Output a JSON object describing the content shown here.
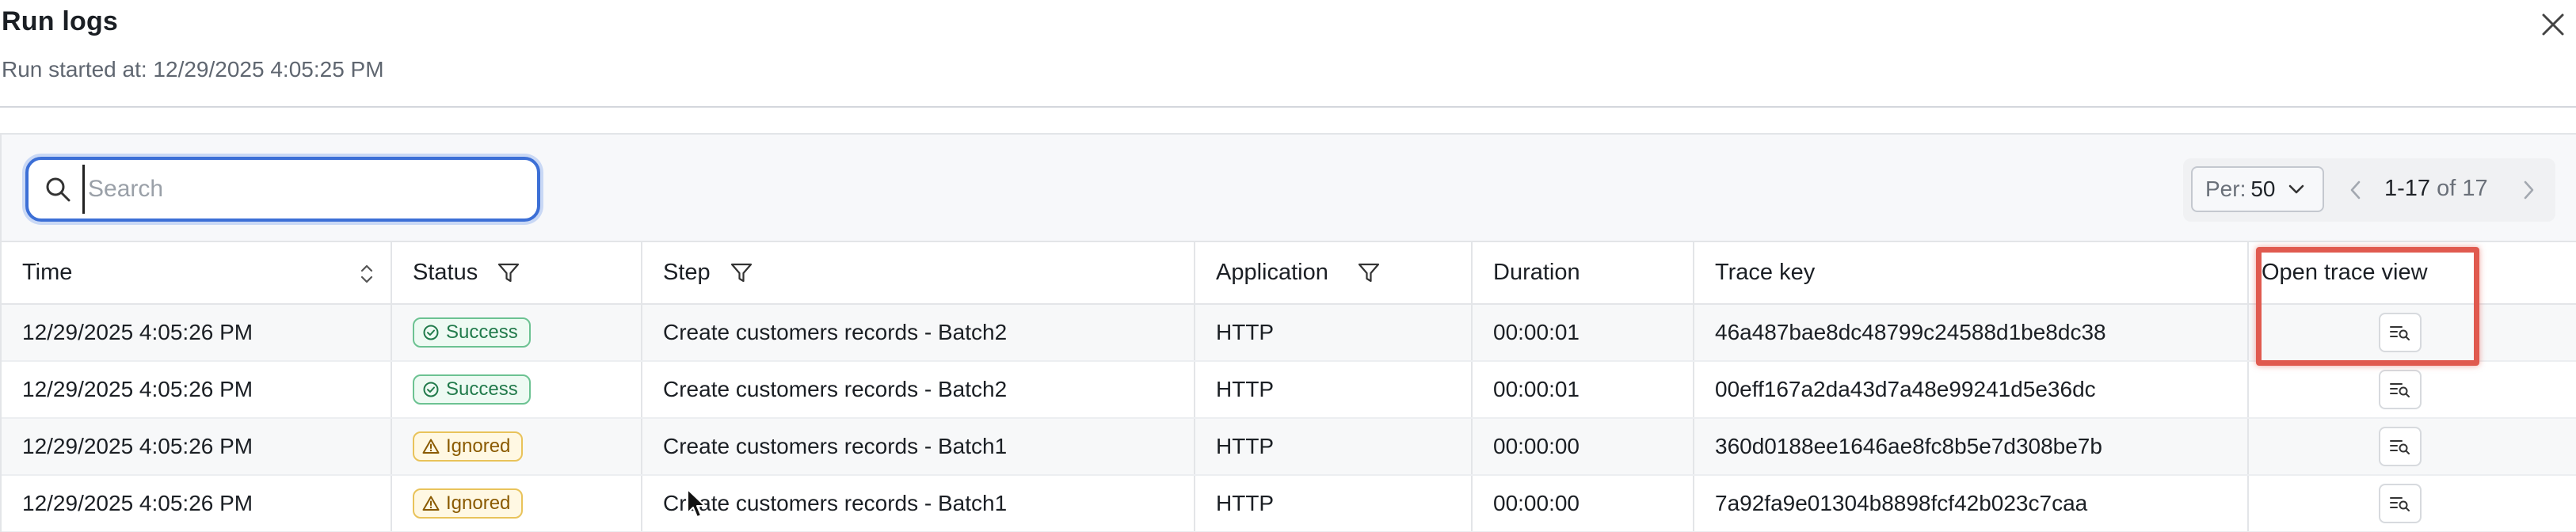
{
  "dialog": {
    "title": "Run logs",
    "subtitle": "Run started at: 12/29/2025 4:05:25 PM"
  },
  "toolbar": {
    "search_placeholder": "Search",
    "per_label": "Per:",
    "per_value": "50",
    "range": "1-17",
    "of_total": "of 17"
  },
  "table": {
    "headers": {
      "time": "Time",
      "status": "Status",
      "step": "Step",
      "application": "Application",
      "duration": "Duration",
      "trace_key": "Trace key",
      "open_trace_view": "Open trace view"
    },
    "rows": [
      {
        "time": "12/29/2025 4:05:26 PM",
        "status": "Success",
        "step": "Create customers records - Batch2",
        "application": "HTTP",
        "duration": "00:00:01",
        "trace_key": "46a487bae8dc48799c24588d1be8dc38"
      },
      {
        "time": "12/29/2025 4:05:26 PM",
        "status": "Success",
        "step": "Create customers records - Batch2",
        "application": "HTTP",
        "duration": "00:00:01",
        "trace_key": "00eff167a2da43d7a48e99241d5e36dc"
      },
      {
        "time": "12/29/2025 4:05:26 PM",
        "status": "Ignored",
        "step": "Create customers records - Batch1",
        "application": "HTTP",
        "duration": "00:00:00",
        "trace_key": "360d0188ee1646ae8fc8b5e7d308be7b"
      },
      {
        "time": "12/29/2025 4:05:26 PM",
        "status": "Ignored",
        "step": "Create customers records - Batch1",
        "application": "HTTP",
        "duration": "00:00:00",
        "trace_key": "7a92fa9e01304b8898fcf42b023c7caa"
      }
    ]
  },
  "colors": {
    "accent_focus": "#3c6fd6",
    "success": "#217a4b",
    "ignored": "#8a5a00",
    "highlight": "#e05a4f"
  },
  "icons": {
    "close": "close-icon",
    "search": "search-icon",
    "filter": "filter-icon",
    "sort": "sort-icon",
    "success": "check-circle-icon",
    "ignored": "warning-triangle-icon",
    "open_trace": "trace-view-icon"
  }
}
